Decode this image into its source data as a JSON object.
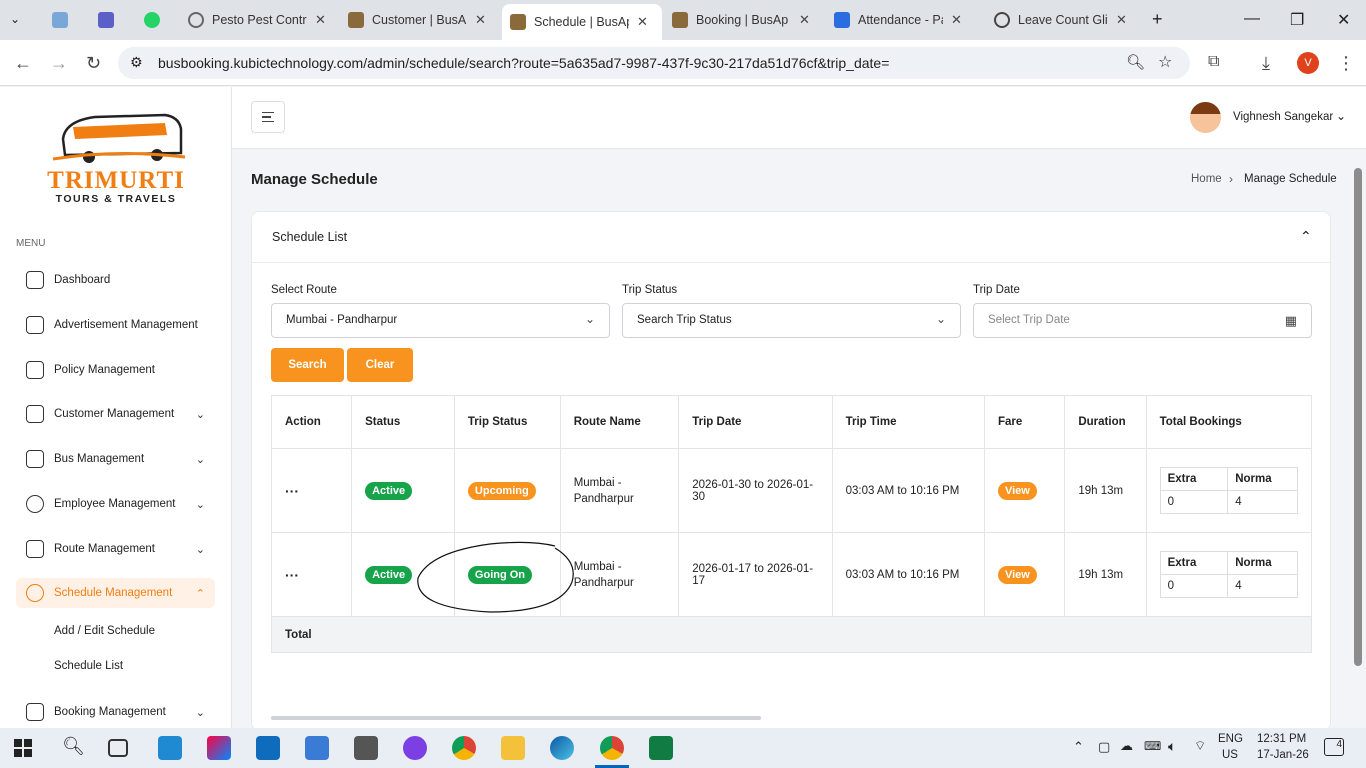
{
  "browser": {
    "tabs": [
      {
        "title": "Pesto Pest Contro"
      },
      {
        "title": "Customer | BusAp"
      },
      {
        "title": "Schedule | BusAp"
      },
      {
        "title": "Booking | BusAp"
      },
      {
        "title": "Attendance - Pag"
      },
      {
        "title": "Leave Count Glit"
      }
    ],
    "url": "busbooking.kubictechnology.com/admin/schedule/search?route=5a635ad7-9987-437f-9c30-217da51d76cf&trip_date=",
    "profile_letter": "V"
  },
  "brand": {
    "name": "TRIMURTI",
    "tagline": "TOURS & TRAVELS"
  },
  "sidebar": {
    "menu_label": "MENU",
    "items": [
      {
        "label": "Dashboard"
      },
      {
        "label": "Advertisement Management"
      },
      {
        "label": "Policy Management"
      },
      {
        "label": "Customer Management"
      },
      {
        "label": "Bus Management"
      },
      {
        "label": "Employee Management"
      },
      {
        "label": "Route Management"
      },
      {
        "label": "Schedule Management"
      },
      {
        "label": "Booking Management"
      }
    ],
    "sub_items": [
      {
        "label": "Add / Edit Schedule"
      },
      {
        "label": "Schedule List"
      }
    ]
  },
  "header": {
    "user_name": "Vighnesh Sangekar"
  },
  "page": {
    "title": "Manage Schedule",
    "breadcrumb_home": "Home",
    "breadcrumb_current": "Manage Schedule"
  },
  "card": {
    "title": "Schedule List"
  },
  "filters": {
    "route_label": "Select Route",
    "route_value": "Mumbai - Pandharpur",
    "status_label": "Trip Status",
    "status_value": "Search Trip Status",
    "date_label": "Trip Date",
    "date_placeholder": "Select Trip Date",
    "search_btn": "Search",
    "clear_btn": "Clear"
  },
  "table": {
    "headers": [
      "Action",
      "Status",
      "Trip Status",
      "Route Name",
      "Trip Date",
      "Trip Time",
      "Fare",
      "Duration",
      "Total Bookings"
    ],
    "rows": [
      {
        "action": "···",
        "status": "Active",
        "trip_status": "Upcoming",
        "route_line1": "Mumbai -",
        "route_line2": "Pandharpur",
        "trip_date": "2026-01-30 to 2026-01-30",
        "trip_time": "03:03 AM to 10:16 PM",
        "fare": "View",
        "duration": "19h 13m",
        "b_h1": "Extra",
        "b_h2": "Norma",
        "b_v1": "0",
        "b_v2": "4"
      },
      {
        "action": "···",
        "status": "Active",
        "trip_status": "Going On",
        "route_line1": "Mumbai -",
        "route_line2": "Pandharpur",
        "trip_date": "2026-01-17 to 2026-01-17",
        "trip_time": "03:03 AM to 10:16 PM",
        "fare": "View",
        "duration": "19h 13m",
        "b_h1": "Extra",
        "b_h2": "Norma",
        "b_v1": "0",
        "b_v2": "4"
      }
    ],
    "total_label": "Total"
  },
  "taskbar": {
    "lang1": "ENG",
    "lang2": "US",
    "time": "12:31 PM",
    "date": "17-Jan-26",
    "notif": "4"
  },
  "colors": {
    "accent": "#f7931e",
    "active_green": "#16a34a"
  }
}
